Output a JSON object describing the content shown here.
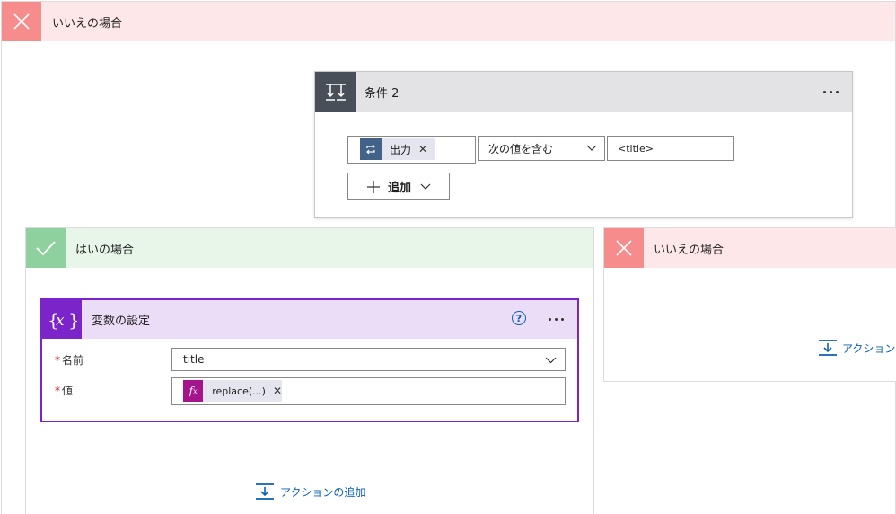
{
  "outer_no_branch": {
    "title": "いいえの場合"
  },
  "condition": {
    "title": "条件 2",
    "left_token": "出力",
    "operator": "次の値を含む",
    "right_value": "<title>",
    "add_label": "追加"
  },
  "yes_branch": {
    "title": "はいの場合",
    "add_action_label": "アクションの追加"
  },
  "set_variable": {
    "title": "変数の設定",
    "name_label": "名前",
    "name_value": "title",
    "value_label": "値",
    "value_token": "replace(...)"
  },
  "inner_no_branch": {
    "title": "いいえの場合",
    "add_action_label": "アクション"
  },
  "colors": {
    "no_header": "#fde7e9",
    "no_icon": "#f78c8c",
    "yes_header": "#e8f6ea",
    "yes_icon": "#8fd19e",
    "variable_accent": "#7b24c9",
    "variable_header": "#ebdcf7",
    "condition_icon": "#484f58",
    "link": "#0a60b6"
  }
}
